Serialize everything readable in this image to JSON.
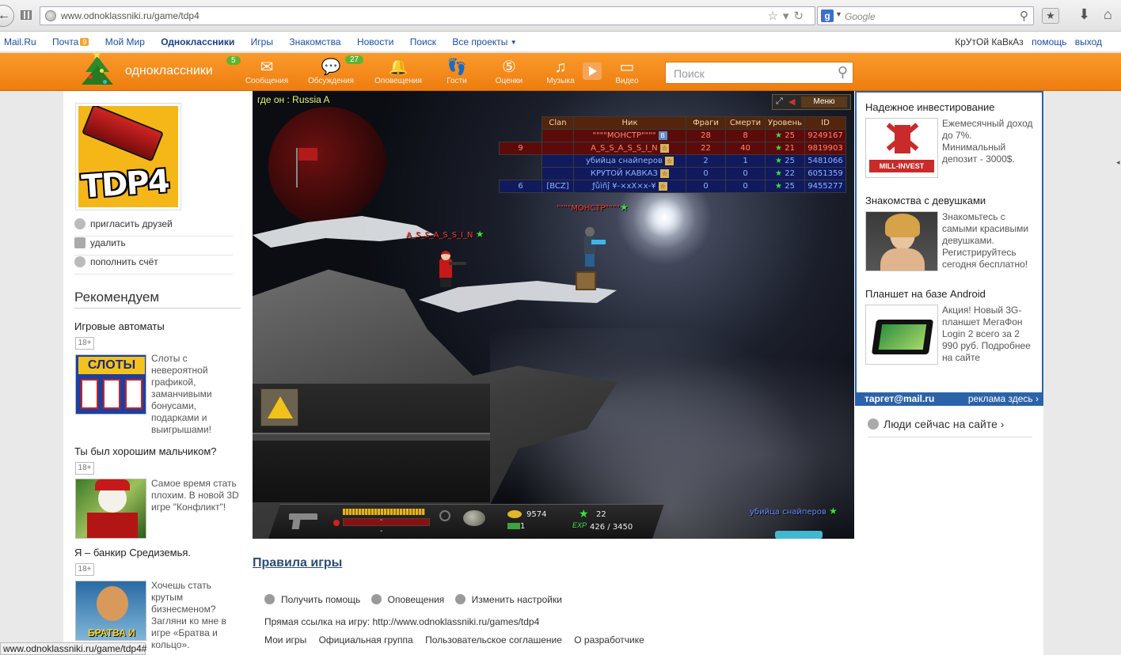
{
  "browser": {
    "url": "www.odnoklassniki.ru/game/tdp4",
    "search_placeholder": "Google",
    "status_url": "www.odnoklassniki.ru/game/tdp4#"
  },
  "portal": {
    "items": [
      "Mail.Ru",
      "Почта",
      "Мой Мир",
      "Одноклассники",
      "Игры",
      "Знакомства",
      "Новости",
      "Поиск",
      "Все проекты"
    ],
    "mail_count": "9",
    "user": "КрУтОй КаВкАз",
    "help": "помощь",
    "logout": "выход"
  },
  "header": {
    "logo": "одноклассники",
    "logo_badge": "5",
    "discussions_badge": "27",
    "nav": [
      "Сообщения",
      "Обсуждения",
      "Оповещения",
      "Гости",
      "Оценки",
      "Музыка",
      "Видео"
    ],
    "search_placeholder": "Поиск"
  },
  "sidebar": {
    "game_logo": "TDP4",
    "links": [
      "пригласить друзей",
      "удалить",
      "пополнить счёт"
    ],
    "recommend_title": "Рекомендуем",
    "recommendations": [
      {
        "title": "Игровые автоматы",
        "age": "18+",
        "thumb": "СЛОТЫ",
        "text": "Слоты с невероятной графикой, заманчивыми бонусами, подарками и выигрышами!"
      },
      {
        "title": "Ты был хорошим мальчиком?",
        "age": "18+",
        "thumb": "",
        "text": "Самое время стать плохим. В новой 3D игре \"Конфликт\"!"
      },
      {
        "title": "Я – банкир Средиземья.",
        "age": "18+",
        "thumb": "БРАТВА И",
        "text": "Хочешь стать крутым бизнесменом? Загляни ко мне в игре «Братва и кольцо»."
      }
    ]
  },
  "game": {
    "location": "где он : Russia A",
    "menu_label": "Меню",
    "score_headers": [
      "Clan",
      "Ник",
      "Фраги",
      "Смерти",
      "Уровень",
      "ID"
    ],
    "score_rows": [
      {
        "side": "red",
        "pre": "",
        "clan": "",
        "nick": "\"\"\"\"МОНСТР\"\"\"\"",
        "rank": "В",
        "frags": "28",
        "deaths": "8",
        "level": "25",
        "id": "9249167"
      },
      {
        "side": "red",
        "pre": "9",
        "clan": "",
        "nick": "A_S_S_A_S_S_I_N",
        "rank": "☆",
        "frags": "22",
        "deaths": "40",
        "level": "21",
        "id": "9819903"
      },
      {
        "side": "blue",
        "pre": "",
        "clan": "",
        "nick": "убийца снайперов",
        "rank": "☆",
        "frags": "2",
        "deaths": "1",
        "level": "25",
        "id": "5481066"
      },
      {
        "side": "blue",
        "pre": "",
        "clan": "",
        "nick": "КРУТОЙ КАВКАЗ",
        "rank": "☆",
        "frags": "0",
        "deaths": "0",
        "level": "22",
        "id": "6051359"
      },
      {
        "side": "blue",
        "pre": "6",
        "clan": "[BCZ]",
        "nick": "ƒůìňĵ ¥-×xX×x-¥",
        "rank": "☆",
        "frags": "0",
        "deaths": "0",
        "level": "25",
        "id": "9455277"
      }
    ],
    "tag_assassin": "A_S_S_A_S_S_I_N",
    "tag_monster": "\"\"\"\"МОНСТР\"\"\"\"",
    "tag_sniper": "убийца снайперов",
    "hud": {
      "coins": "9574",
      "cash": "1",
      "level": "22",
      "exp": "426 / 3450",
      "exp_label": "EXP"
    }
  },
  "below": {
    "rules": "Правила игры",
    "actions": [
      "Получить помощь",
      "Оповещения",
      "Изменить настройки"
    ],
    "direct_link": "Прямая ссылка на игру: http://www.odnoklassniki.ru/games/tdp4",
    "links": [
      "Мои игры",
      "Официальная группа",
      "Пользовательское соглашение",
      "О разработчике"
    ]
  },
  "ads": {
    "items": [
      {
        "title": "Надежное инвестирование",
        "thumb": "MILL-INVEST",
        "text": "Ежемесячный доход до 7%. Минимальный депозит - 3000$."
      },
      {
        "title": "Знакомства с девушками",
        "thumb": "",
        "text": "Знакомьтесь с самыми красивыми девушками. Регистрируйтесь сегодня бесплатно!"
      },
      {
        "title": "Планшет на базе Android",
        "thumb": "",
        "text": "Акция! Новый 3G-планшет МегаФон Login 2 всего за 2 990 руб. Подробнее на сайте"
      }
    ],
    "brand": "таргет@mail.ru",
    "ad_here": "реклама здесь ›",
    "people_online": "Люди сейчас на сайте ›"
  }
}
